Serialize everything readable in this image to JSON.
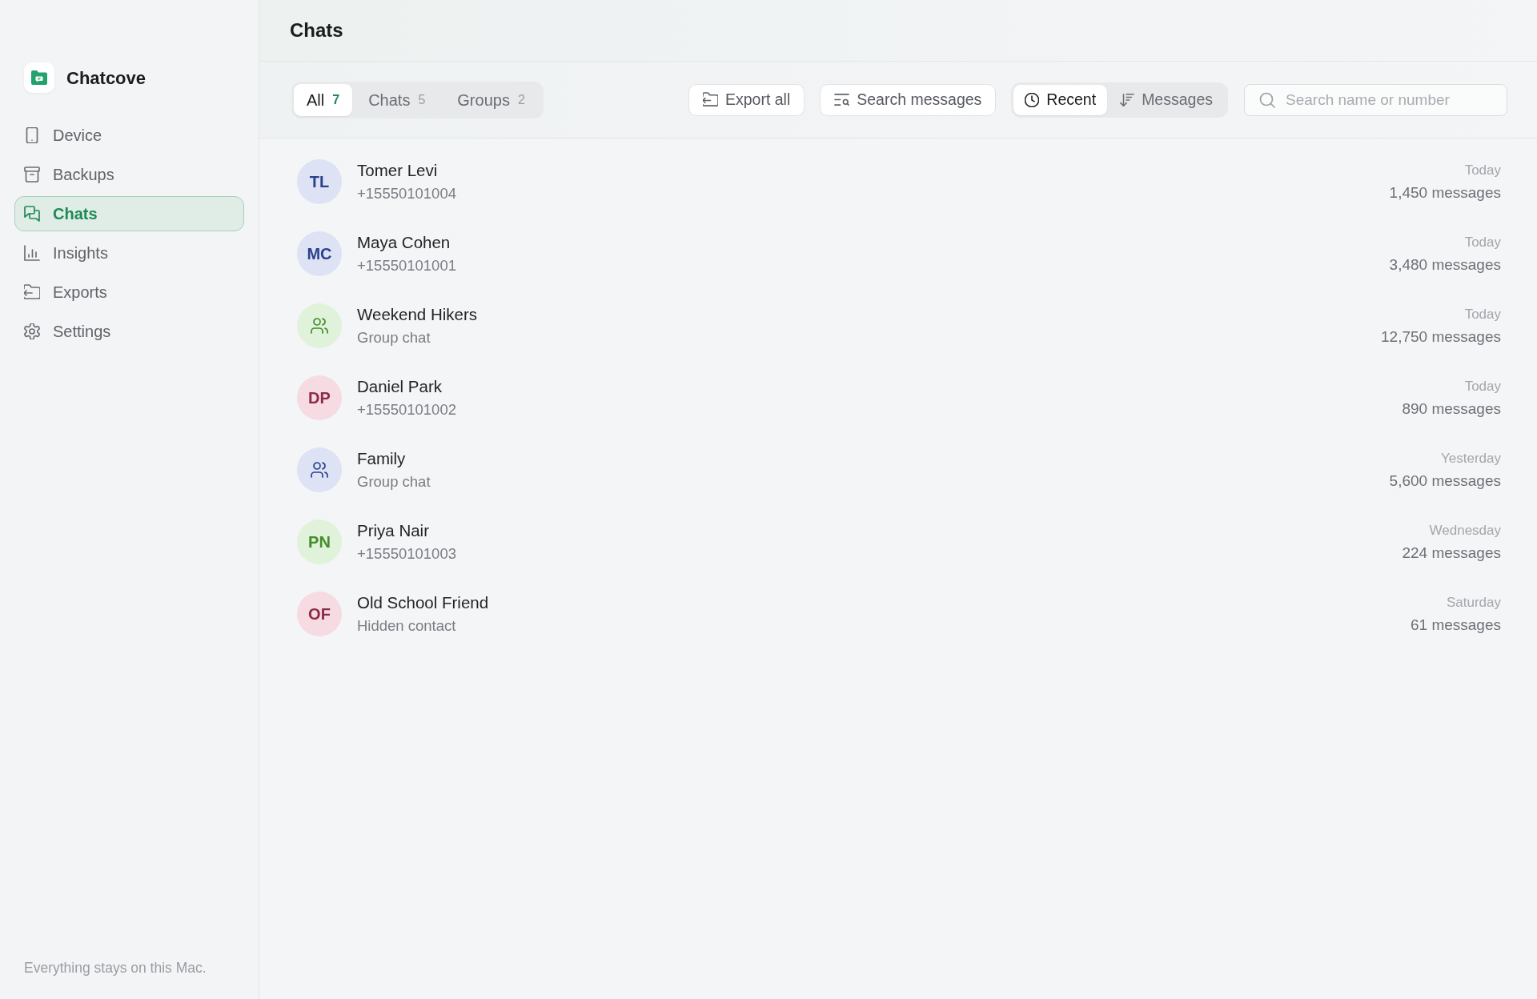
{
  "app": {
    "name": "Chatcove"
  },
  "sidebar": {
    "items": [
      {
        "label": "Device",
        "selected": false
      },
      {
        "label": "Backups",
        "selected": false
      },
      {
        "label": "Chats",
        "selected": true
      },
      {
        "label": "Insights",
        "selected": false
      },
      {
        "label": "Exports",
        "selected": false
      },
      {
        "label": "Settings",
        "selected": false
      }
    ],
    "footer": "Everything stays on this Mac."
  },
  "header": {
    "title": "Chats"
  },
  "toolbar": {
    "filter_tabs": [
      {
        "label": "All",
        "count": "7",
        "selected": true
      },
      {
        "label": "Chats",
        "count": "5",
        "selected": false
      },
      {
        "label": "Groups",
        "count": "2",
        "selected": false
      }
    ],
    "buttons": [
      {
        "label": "Export all"
      },
      {
        "label": "Search messages"
      }
    ],
    "sort_tabs": [
      {
        "label": "Recent",
        "selected": true
      },
      {
        "label": "Messages",
        "selected": false
      }
    ],
    "search": {
      "placeholder": "Search name or number"
    }
  },
  "chats": [
    {
      "kind": "person",
      "initials": "TL",
      "color": "#dde2f4",
      "name": "Tomer Levi",
      "detail": "+15550101004",
      "time": "Today",
      "count": "1,450 messages"
    },
    {
      "kind": "person",
      "initials": "MC",
      "color": "#dde2f4",
      "name": "Maya Cohen",
      "detail": "+15550101001",
      "time": "Today",
      "count": "3,480 messages"
    },
    {
      "kind": "group",
      "color": "#e0f2da",
      "name": "Weekend Hikers",
      "detail": "Group chat",
      "time": "Today",
      "count": "12,750 messages"
    },
    {
      "kind": "person",
      "initials": "DP",
      "color": "#f6dbe2",
      "name": "Daniel Park",
      "detail": "+15550101002",
      "time": "Today",
      "count": "890 messages"
    },
    {
      "kind": "group",
      "color": "#dde2f4",
      "name": "Family",
      "detail": "Group chat",
      "time": "Yesterday",
      "count": "5,600 messages"
    },
    {
      "kind": "person",
      "initials": "PN",
      "color": "#e0f2da",
      "name": "Priya Nair",
      "detail": "+15550101003",
      "time": "Wednesday",
      "count": "224 messages"
    },
    {
      "kind": "person",
      "initials": "OF",
      "color": "#f6dbe2",
      "name": "Old School Friend",
      "detail": "Hidden contact",
      "time": "Saturday",
      "count": "61 messages"
    }
  ]
}
